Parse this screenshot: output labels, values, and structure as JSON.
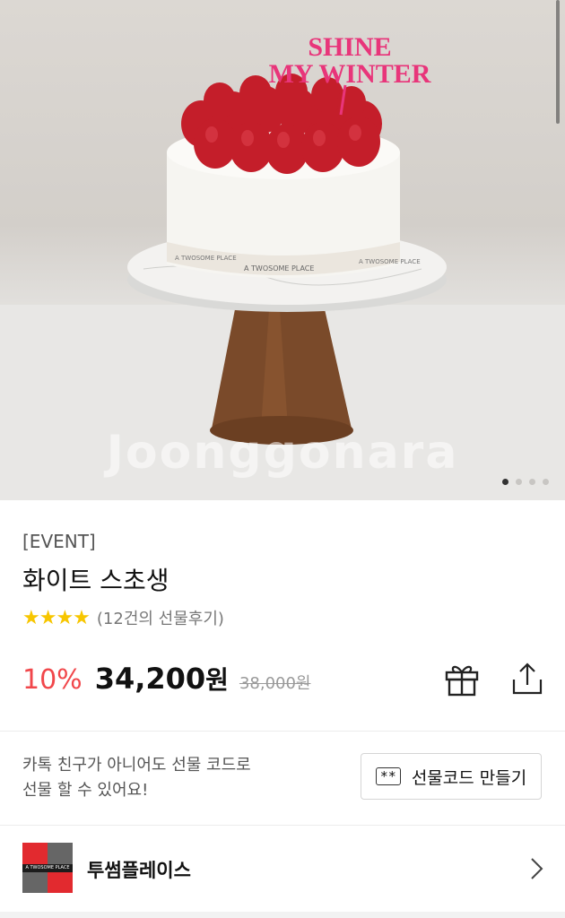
{
  "hero": {
    "topper_line1": "SHINE",
    "topper_line2": "MY WINTER",
    "band_text_left": "A TWOSOME PLACE",
    "band_text_center": "A TWOSOME PLACE",
    "band_text_right": "A TWOSOME PLACE",
    "watermark": "Joonggonara",
    "slide_count": 4,
    "active_slide": 1
  },
  "product": {
    "category": "[EVENT]",
    "title": "화이트 스초생",
    "rating_stars": 4,
    "stars_text": "★★★★",
    "review_count": "(12건의 선물후기)",
    "discount": "10%",
    "price": "34,200",
    "currency": "원",
    "original_price": "38,000원"
  },
  "actions": {
    "gift_icon": "gift-icon",
    "share_icon": "share-icon"
  },
  "gift_code": {
    "message_line1": "카톡 친구가 아니어도 선물 코드로",
    "message_line2": "선물 할 수 있어요!",
    "button_icon_text": "**",
    "button_label": "선물코드 만들기"
  },
  "brand": {
    "logo_text": "A TWOSOME PLACE",
    "name": "투썸플레이스",
    "chevron_icon": "chevron-right-icon"
  },
  "colors": {
    "discount": "#f1474b",
    "stars": "#f7c600",
    "topper": "#e8357a",
    "brand_red": "#e22a2f"
  }
}
